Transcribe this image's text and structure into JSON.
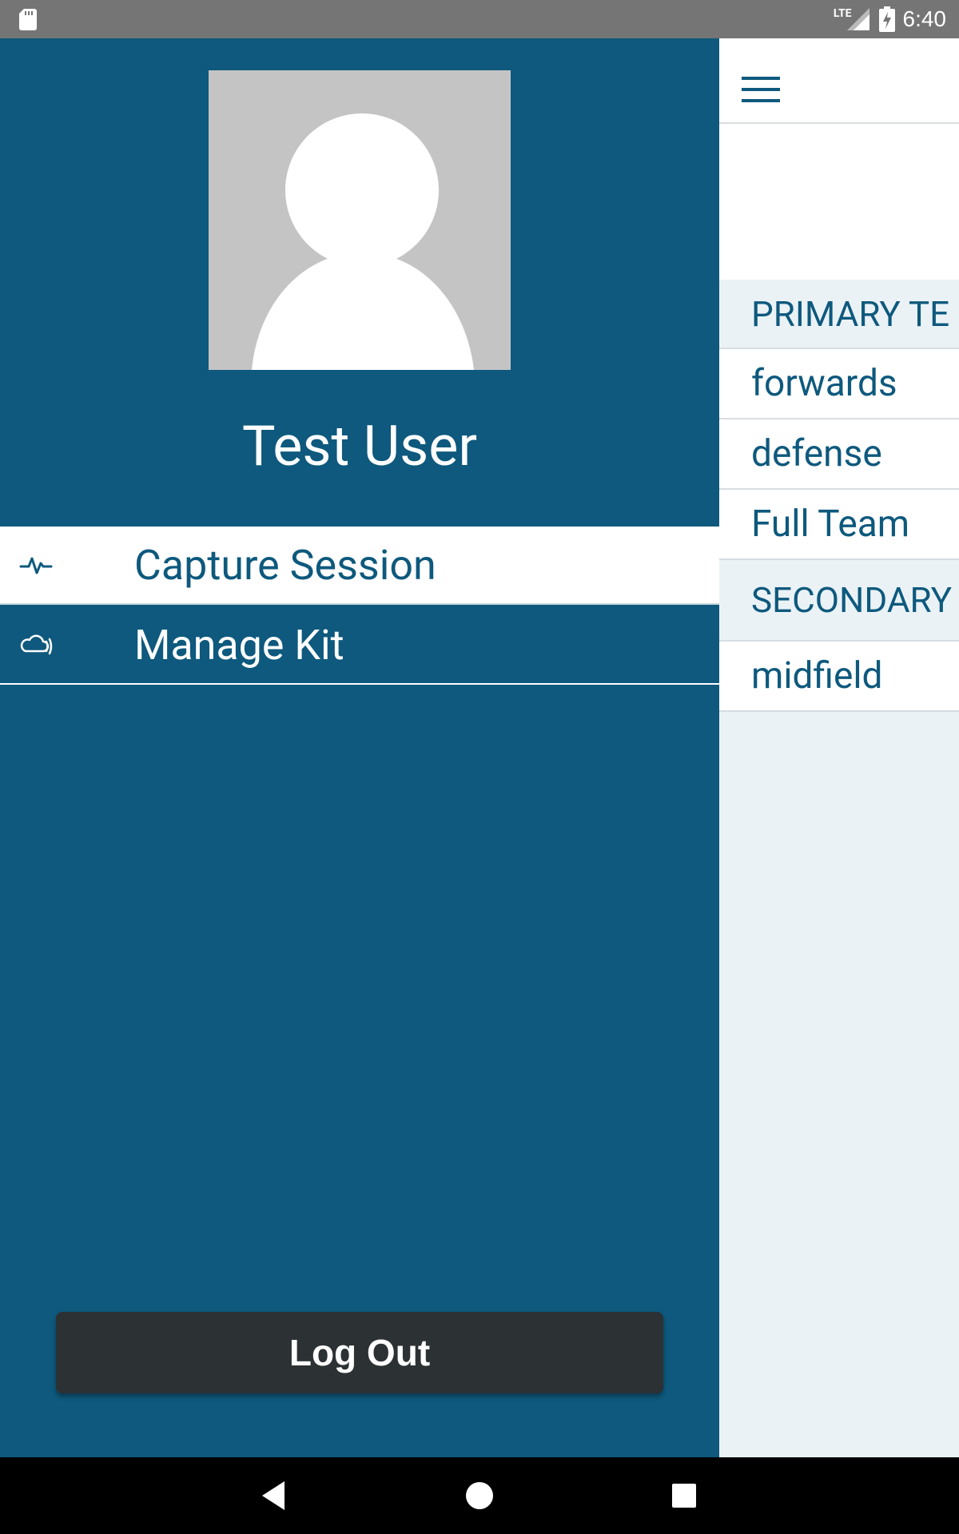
{
  "status_bar": {
    "time": "6:40",
    "network": "LTE",
    "icons": [
      "sd-card-icon",
      "signal-icon",
      "battery-charging-icon"
    ]
  },
  "drawer": {
    "user_name": "Test User",
    "avatar": "default-avatar-icon",
    "items": [
      {
        "label": "Capture Session",
        "icon": "pulse-icon",
        "active": true
      },
      {
        "label": "Manage Kit",
        "icon": "cloud-wireless-icon",
        "active": false
      }
    ],
    "logout_label": "Log Out"
  },
  "main": {
    "menu_icon": "hamburger-menu-icon",
    "sections": [
      {
        "header": "PRIMARY TE",
        "rows": [
          "forwards",
          "defense",
          "Full Team"
        ]
      },
      {
        "header": "SECONDARY",
        "rows": [
          "midfield"
        ]
      }
    ]
  },
  "colors": {
    "brand_blue": "#0e597d",
    "status_bar": "#757575",
    "list_bg": "#eaf2f6",
    "button_dark": "#2c3134"
  }
}
